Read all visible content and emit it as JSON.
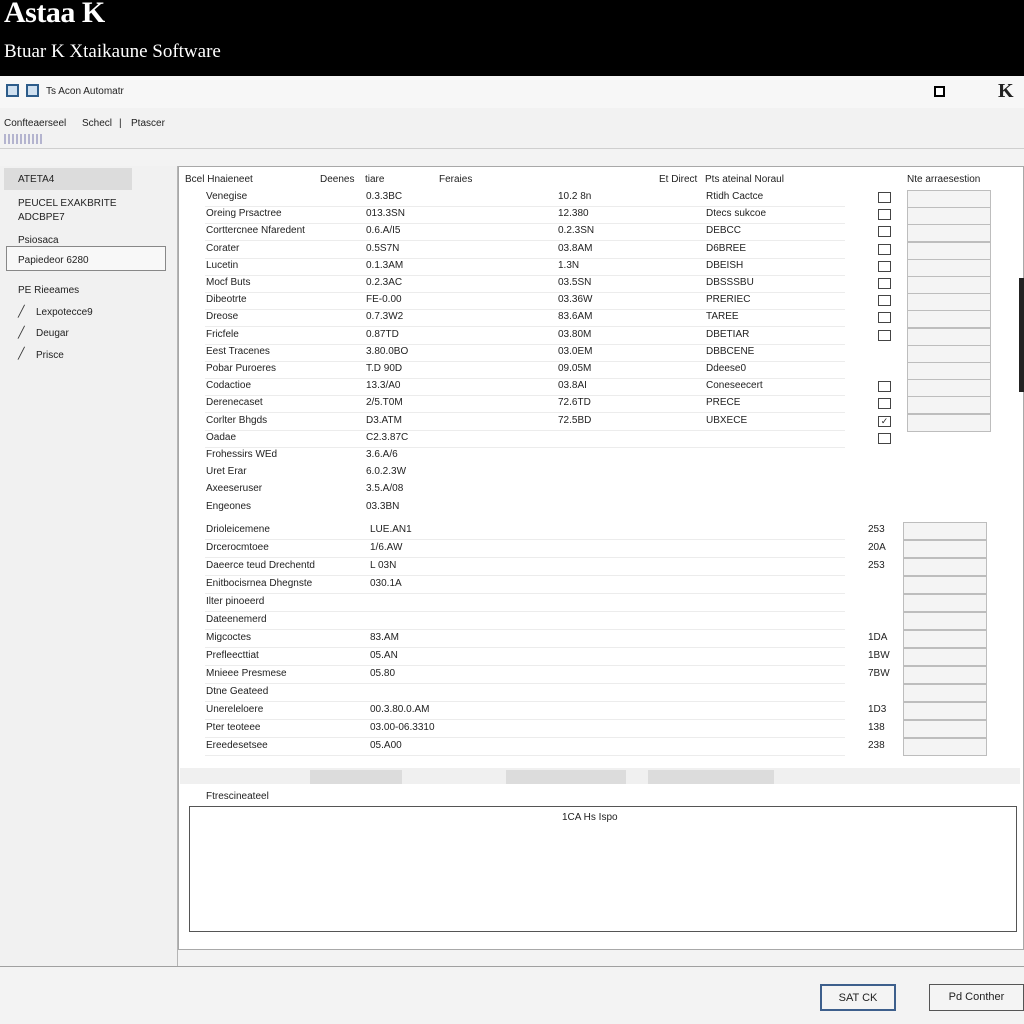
{
  "header": {
    "brand": "Astaa K",
    "subtitle": "Btuar K Xtaikaune Software"
  },
  "toolbar": {
    "app_name": "Ts Acon Automatr",
    "window_letter": "K"
  },
  "menu": {
    "items": [
      "Confteaerseel",
      "Schecl",
      "Ptascer"
    ]
  },
  "sidebar": {
    "header": "ATETA4",
    "items": [
      "PEUCEL EXAKBRITE",
      "ADCBPE7",
      "Psiosaca",
      "Papiedeor 6280",
      "PE Rieeames",
      "Lexpotecce9",
      "Deugar",
      "Prisce"
    ]
  },
  "columns": {
    "name": "Bcel Hnaieneet",
    "devices": "Deenes",
    "rate": "tiare",
    "params": "Feraies",
    "direct": "Et Direct",
    "status": "Pts ateinal Noraul",
    "extra": "Nte arraesestion"
  },
  "rows": [
    {
      "name": "Venegise",
      "v1": "0.3.3BC",
      "v2": "10.2 8n",
      "status": "Rtidh Cactce",
      "cb": false
    },
    {
      "name": "Oreing Prsactree",
      "v1": "013.3SN",
      "v2": "12.380",
      "status": "Dtecs sukcoe",
      "cb": false
    },
    {
      "name": "Corttercnee Nfaredent",
      "v1": "0.6.A/I5",
      "v2": "0.2.3SN",
      "status": "DEBCC",
      "cb": false
    },
    {
      "name": "Corater",
      "v1": "0.5S7N",
      "v2": "03.8AM",
      "status": "D6BREE",
      "cb": false
    },
    {
      "name": "Lucetin",
      "v1": "0.1.3AM",
      "v2": "1.3N",
      "status": "DBEISH",
      "cb": false
    },
    {
      "name": "Mocf Buts",
      "v1": "0.2.3AC",
      "v2": "03.5SN",
      "status": "DBSSSBU",
      "cb": false
    },
    {
      "name": "Dibeotrte",
      "v1": "FE-0.00",
      "v2": "03.36W",
      "status": "PRERIEC",
      "cb": false
    },
    {
      "name": "Dreose",
      "v1": "0.7.3W2",
      "v2": "83.6AM",
      "status": "TAREE",
      "cb": false
    },
    {
      "name": "Fricfele",
      "v1": "0.87TD",
      "v2": "03.80M",
      "status": "DBETIAR",
      "cb": false
    },
    {
      "name": "Eest Tracenes",
      "v1": "3.80.0BO",
      "v2": "03.0EM",
      "status": "DBBCENE",
      "cb": null
    },
    {
      "name": "Pobar Puroeres",
      "v1": "T.D 90D",
      "v2": "09.05M",
      "status": "Ddeese0",
      "cb": null
    },
    {
      "name": "Codactioe",
      "v1": "13.3/A0",
      "v2": "03.8AI",
      "status": "Coneseecert",
      "cb": false
    },
    {
      "name": "Derenecaset",
      "v1": "2/5.T0M",
      "v2": "72.6TD",
      "status": "PRECE",
      "cb": false
    },
    {
      "name": "Corlter Bhgds",
      "v1": "D3.ATM",
      "v2": "72.5BD",
      "status": "UBXECE",
      "cb": true
    },
    {
      "name": "Oadae",
      "v1": "C2.3.87C",
      "v2": "",
      "status": "",
      "cb": false
    },
    {
      "name": "Frohessirs WEd",
      "v1": "3.6.A/6",
      "v2": "",
      "status": "",
      "cb": null
    },
    {
      "name": "Uret Erar",
      "v1": "6.0.2.3W",
      "v2": "",
      "status": "",
      "cb": null
    },
    {
      "name": "Axeeseruser",
      "v1": "3.5.A/08",
      "v2": "",
      "status": "",
      "cb": null
    },
    {
      "name": "Engeones",
      "v1": "03.3BN",
      "v2": "",
      "status": "",
      "cb": null
    }
  ],
  "rows2": [
    {
      "name": "Drioleicemene",
      "v1": "LUE.AN1",
      "num": "253"
    },
    {
      "name": "Drcerocmtoee",
      "v1": "1/6.AW",
      "num": "20A"
    },
    {
      "name": "Daeerce teud Drechentd",
      "v1": "L 03N",
      "num": "253"
    },
    {
      "name": "Enitbocisrnea Dhegnste",
      "v1": "030.1A",
      "num": ""
    },
    {
      "name": "Ilter pinoeerd",
      "v1": "",
      "num": ""
    },
    {
      "name": "Dateenemerd",
      "v1": "",
      "num": ""
    },
    {
      "name": "Migcoctes",
      "v1": "83.AM",
      "num": "1DA"
    },
    {
      "name": "Prefleecttiat",
      "v1": "05.AN",
      "num": "1BW"
    },
    {
      "name": "Mnieee Presmese",
      "v1": "05.80",
      "num": "7BW"
    },
    {
      "name": "Dtne Geateed",
      "v1": "",
      "num": ""
    },
    {
      "name": "Unereleloere",
      "v1": "00.3.80.0.AM",
      "num": "1D3"
    },
    {
      "name": "Pter teoteee",
      "v1": "03.00-06.3310",
      "num": "138"
    },
    {
      "name": "Ereedesetsee",
      "v1": "05.A00",
      "num": "238"
    }
  ],
  "preview": {
    "label": "Ftrescineateel",
    "text": "1CA Hs Ispo"
  },
  "buttons": {
    "ok": "SAT CK",
    "continue": "Pd Conther"
  }
}
